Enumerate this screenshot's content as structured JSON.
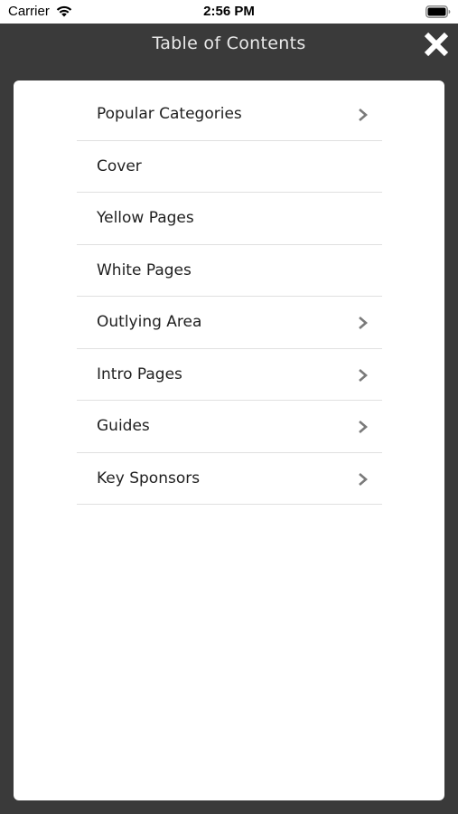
{
  "status_bar": {
    "carrier": "Carrier",
    "time": "2:56 PM",
    "wifi_icon": "wifi-icon",
    "battery_icon": "battery-icon"
  },
  "header": {
    "title": "Table of Contents",
    "close_icon": "close-icon",
    "background": "#3a3a3a"
  },
  "toc": {
    "items": [
      {
        "label": "Popular Categories",
        "has_chevron": true
      },
      {
        "label": "Cover",
        "has_chevron": false
      },
      {
        "label": "Yellow Pages",
        "has_chevron": false
      },
      {
        "label": "White Pages",
        "has_chevron": false
      },
      {
        "label": "Outlying Area",
        "has_chevron": true
      },
      {
        "label": "Intro Pages",
        "has_chevron": true
      },
      {
        "label": "Guides",
        "has_chevron": true
      },
      {
        "label": "Key Sponsors",
        "has_chevron": true
      }
    ]
  }
}
